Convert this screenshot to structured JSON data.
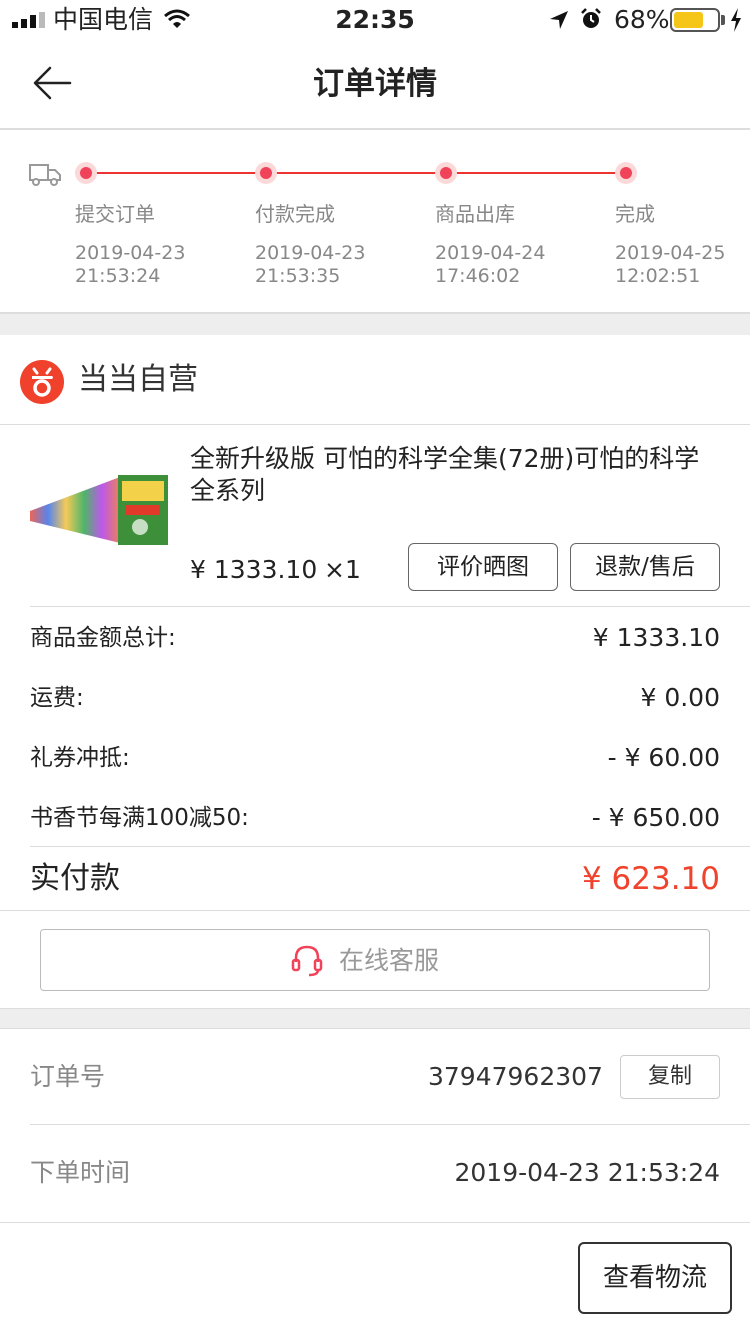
{
  "status_bar": {
    "carrier": "中国电信",
    "time": "22:35",
    "battery_percent": "68%",
    "battery_level": 0.68,
    "battery_color": "#f5c518"
  },
  "nav": {
    "back_icon": "arrow-left-icon",
    "title": "订单详情"
  },
  "progress": {
    "icon": "truck-icon",
    "accent_color": "#f0435a",
    "steps": [
      {
        "label": "提交订单",
        "date": "2019-04-23",
        "time": "21:53:24"
      },
      {
        "label": "付款完成",
        "date": "2019-04-23",
        "time": "21:53:35"
      },
      {
        "label": "商品出库",
        "date": "2019-04-24",
        "time": "17:46:02"
      },
      {
        "label": "完成",
        "date": "2019-04-25",
        "time": "12:02:51"
      }
    ]
  },
  "shop": {
    "logo_icon": "dangdang-logo-icon",
    "name": "当当自营"
  },
  "product": {
    "title": "全新升级版 可怕的科学全集(72册)可怕的科学全系列",
    "price": "¥ 1333.10",
    "quantity": "×1",
    "review_button": "评价晒图",
    "refund_button": "退款/售后"
  },
  "fees": [
    {
      "label": "商品金额总计:",
      "value": "¥ 1333.10"
    },
    {
      "label": "运费:",
      "value": "¥ 0.00"
    },
    {
      "label": "礼券冲抵:",
      "value": "- ¥ 60.00"
    },
    {
      "label": "书香节每满100减50:",
      "value": "- ¥ 650.00"
    }
  ],
  "payment": {
    "label": "实付款",
    "value": "¥ 623.10",
    "value_color": "#f0432e"
  },
  "service": {
    "icon": "headset-icon",
    "label": "在线客服"
  },
  "order_info": {
    "number_label": "订单号",
    "number_value": "37947962307",
    "copy_button": "复制",
    "time_label": "下单时间",
    "time_value": "2019-04-23 21:53:24"
  },
  "footer": {
    "logistics_button": "查看物流"
  }
}
